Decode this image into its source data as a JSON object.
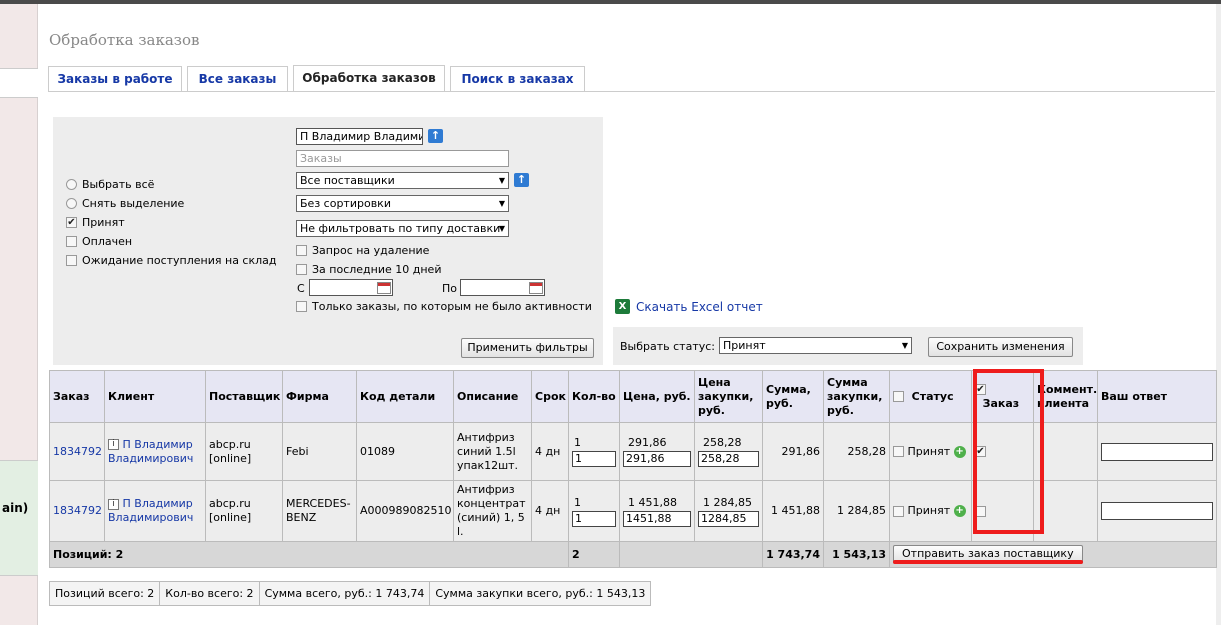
{
  "page": {
    "title": "Обработка заказов"
  },
  "side": {
    "nav_text": "ain)"
  },
  "tabs": [
    {
      "label": "Заказы в работе"
    },
    {
      "label": "Все заказы"
    },
    {
      "label": "Обработка заказов"
    },
    {
      "label": "Поиск в заказах"
    }
  ],
  "filters": {
    "radios": [
      {
        "label": "Выбрать всё"
      },
      {
        "label": "Снять выделение"
      }
    ],
    "checks": [
      {
        "label": "Принят",
        "checked": true
      },
      {
        "label": "Оплачен",
        "checked": false
      },
      {
        "label": "Ожидание поступления на склад",
        "checked": false
      }
    ],
    "client_value": "П Владимир Владимирол",
    "orders_placeholder": "Заказы",
    "supplier_select": "Все поставщики",
    "sort_select": "Без сортировки",
    "delivery_select": "Не фильтровать по типу доставки",
    "opt_delete": "Запрос на удаление",
    "opt_last10": "За последние 10 дней",
    "from_label": "С",
    "to_label": "По",
    "opt_inactive": "Только заказы, по которым не было активности",
    "apply_button": "Применить фильтры"
  },
  "excel": {
    "link": "Скачать Excel отчет",
    "icon": "excel-icon"
  },
  "status": {
    "label": "Выбрать статус:",
    "value": "Принят",
    "save_button": "Сохранить изменения"
  },
  "table": {
    "headers": {
      "order": "Заказ",
      "client": "Клиент",
      "supplier": "Поставщик",
      "firm": "Фирма",
      "code": "Код детали",
      "desc": "Описание",
      "term": "Срок",
      "qty": "Кол-во",
      "price": "Цена, руб.",
      "buy_price": "Цена закупки, руб.",
      "sum": "Сумма, руб.",
      "buy_sum": "Сумма закупки, руб.",
      "status": "Статус",
      "zakaz": "Заказ",
      "comment": "Коммент. клиента",
      "reply": "Ваш ответ"
    },
    "rows": [
      {
        "order": "1834792",
        "client": "П Владимир Владимирович",
        "supplier": "abcp.ru [online]",
        "firm": "Febi",
        "code": "01089",
        "desc": "Антифриз синий 1.5l упак12шт.",
        "term": "4 дн",
        "qty": "1",
        "qty_input": "1",
        "price": "291,86",
        "price_input": "291,86",
        "buy_price": "258,28",
        "buy_price_input": "258,28",
        "sum": "291,86",
        "buy_sum": "258,28",
        "status": "Принят",
        "zakaz_checked": true
      },
      {
        "order": "1834792",
        "client": "П Владимир Владимирович",
        "supplier": "abcp.ru [online]",
        "firm": "MERCEDES-BENZ",
        "code": "A000989082510",
        "desc": "Антифриз концентрат (синий) 1, 5 l.",
        "term": "4 дн",
        "qty": "1",
        "qty_input": "1",
        "price": "1 451,88",
        "price_input": "1451,88",
        "buy_price": "1 284,85",
        "buy_price_input": "1284,85",
        "sum": "1 451,88",
        "buy_sum": "1 284,85",
        "status": "Принят",
        "zakaz_checked": false
      }
    ],
    "total": {
      "label": "Позиций: 2",
      "qty": "2",
      "sum": "1 743,74",
      "buy_sum": "1 543,13",
      "send_button": "Отправить заказ поставщику"
    }
  },
  "summary": {
    "positions": "Позиций всего: 2",
    "qty": "Кол-во всего: 2",
    "sum": "Сумма всего, руб.: 1 743,74",
    "buy_sum": "Сумма закупки всего, руб.: 1 543,13"
  },
  "colors": {
    "link": "#1638a6",
    "highlight": "#ee1c1c",
    "header_bg": "#e6e6f3",
    "row_bg": "#ededed"
  }
}
